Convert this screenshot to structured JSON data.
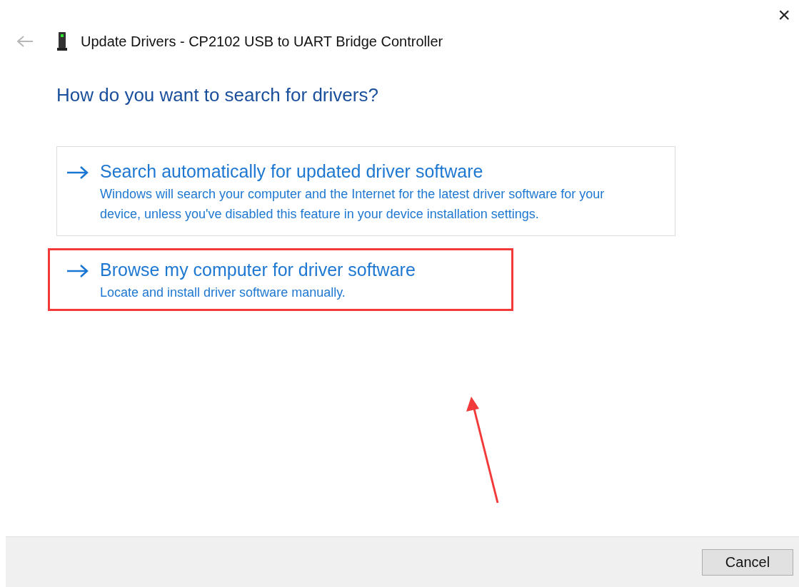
{
  "window": {
    "title": "Update Drivers - CP2102 USB to UART Bridge Controller",
    "close": "×"
  },
  "heading": "How do you want to search for drivers?",
  "options": [
    {
      "title": "Search automatically for updated driver software",
      "description": "Windows will search your computer and the Internet for the latest driver software for your device, unless you've disabled this feature in your device installation settings.",
      "hovered": true,
      "annotated": false
    },
    {
      "title": "Browse my computer for driver software",
      "description": "Locate and install driver software manually.",
      "hovered": false,
      "annotated": true
    }
  ],
  "buttons": [
    "Cancel"
  ]
}
